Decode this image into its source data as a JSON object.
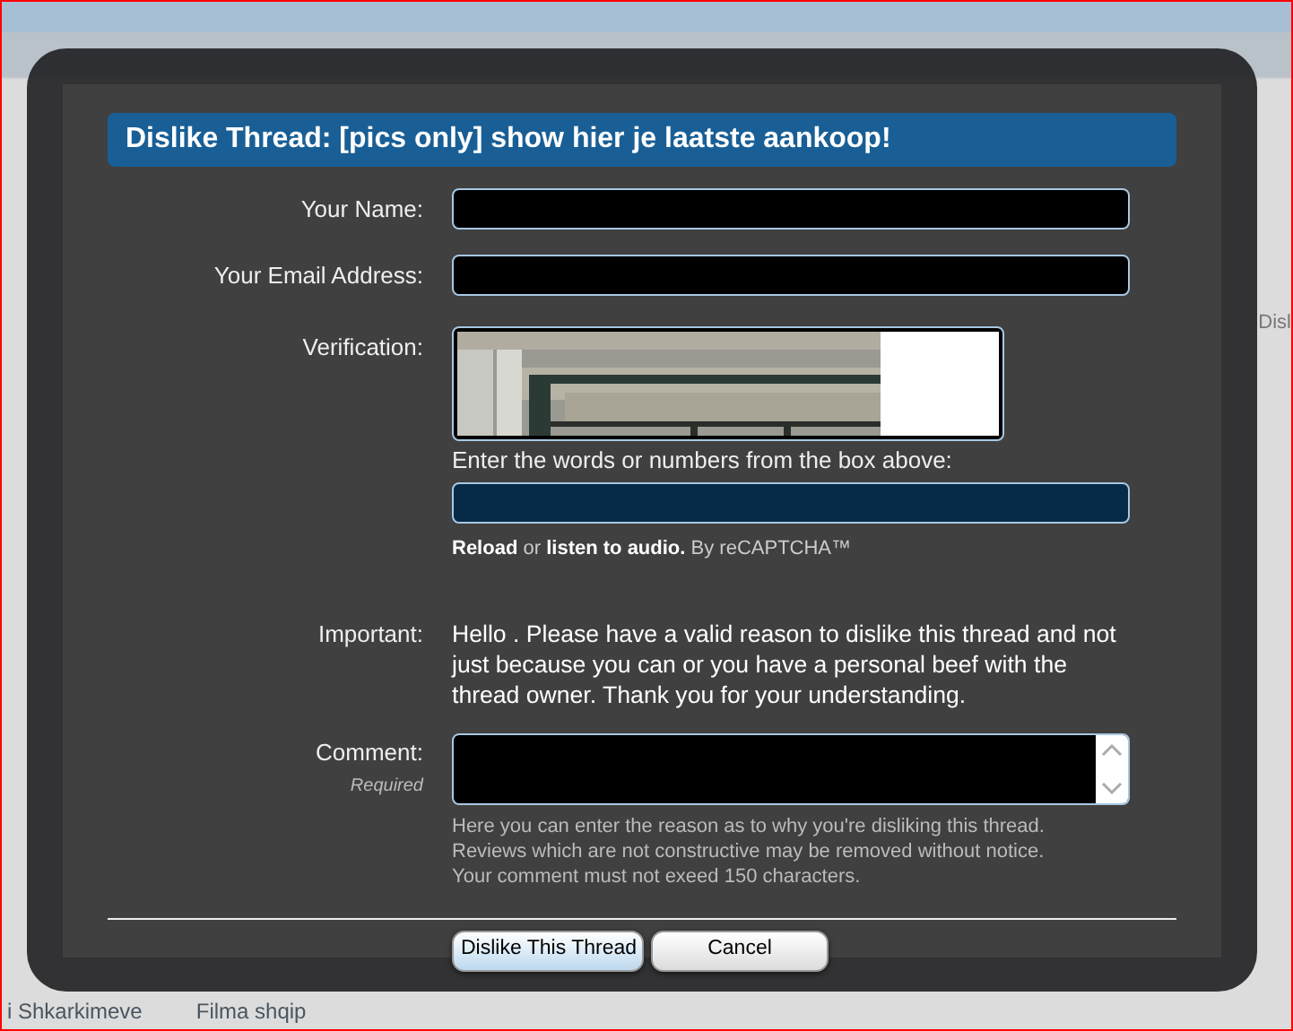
{
  "background_page": {
    "dislike_link": "Disl",
    "footer_breadcrumb": [
      "i Shkarkimeve",
      "Filma shqip"
    ]
  },
  "dialog": {
    "title": "Dislike Thread: [pics only] show hier je laatste aankoop!",
    "fields": [
      {
        "kind": "text",
        "label": "Your Name:"
      },
      {
        "kind": "text",
        "label": "Your Email Address:"
      },
      {
        "kind": "captcha",
        "label": "Verification:",
        "prompt": "Enter the words or numbers from the box above:",
        "reload": "Reload",
        "or": "or",
        "audio": "listen to audio.",
        "by": "By reCAPTCHA™"
      },
      {
        "kind": "note",
        "label": "Important:",
        "text": "Hello . Please have a valid reason to dislike this thread and not just because you can or you have a personal beef with the thread owner. Thank you for your understanding."
      },
      {
        "kind": "textarea",
        "label": "Comment:",
        "hint": "Required",
        "help": [
          "Here you can enter the reason as to why you're disliking this thread.",
          "Reviews which are not constructive may be removed without notice.",
          "Your comment must not exeed 150 characters."
        ]
      }
    ],
    "buttons": [
      {
        "label": "Dislike This Thread",
        "kind": "primary"
      },
      {
        "label": "Cancel",
        "kind": "secondary"
      }
    ]
  }
}
